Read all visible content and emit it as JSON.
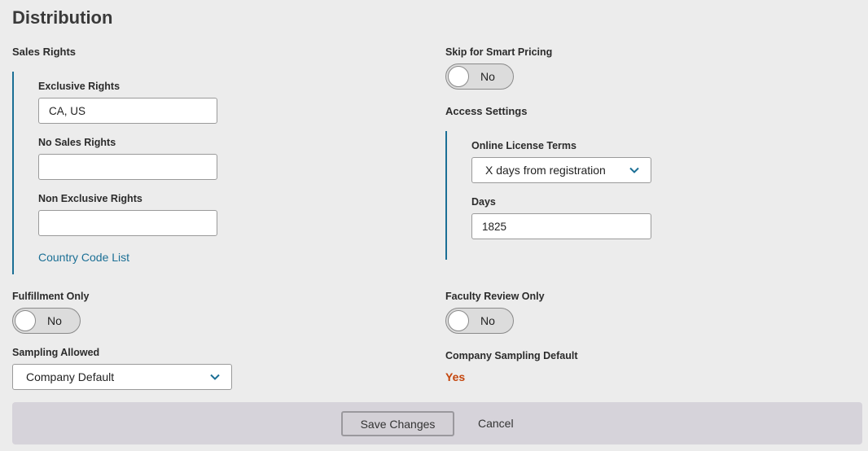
{
  "page": {
    "title": "Distribution"
  },
  "sales_rights": {
    "label": "Sales Rights",
    "exclusive_rights": {
      "label": "Exclusive Rights",
      "value": "CA, US"
    },
    "no_sales_rights": {
      "label": "No Sales Rights",
      "value": ""
    },
    "non_exclusive_rights": {
      "label": "Non Exclusive Rights",
      "value": ""
    },
    "country_code_link": "Country Code List"
  },
  "smart_pricing": {
    "label": "Skip for Smart Pricing",
    "state": "No"
  },
  "access_settings": {
    "label": "Access Settings",
    "online_license_terms": {
      "label": "Online License Terms",
      "value": "X days from registration"
    },
    "days": {
      "label": "Days",
      "value": "1825"
    }
  },
  "fulfillment_only": {
    "label": "Fulfillment Only",
    "state": "No"
  },
  "faculty_review_only": {
    "label": "Faculty Review Only",
    "state": "No"
  },
  "sampling_allowed": {
    "label": "Sampling Allowed",
    "value": "Company Default"
  },
  "company_sampling_default": {
    "label": "Company Sampling Default",
    "value": "Yes"
  },
  "footer": {
    "save_label": "Save Changes",
    "cancel_label": "Cancel"
  },
  "colors": {
    "accent": "#1b6f95",
    "highlight": "#c4450c",
    "footer_bg": "#d6d3da"
  },
  "icons": {
    "dropdown": "chevron-down-icon"
  }
}
